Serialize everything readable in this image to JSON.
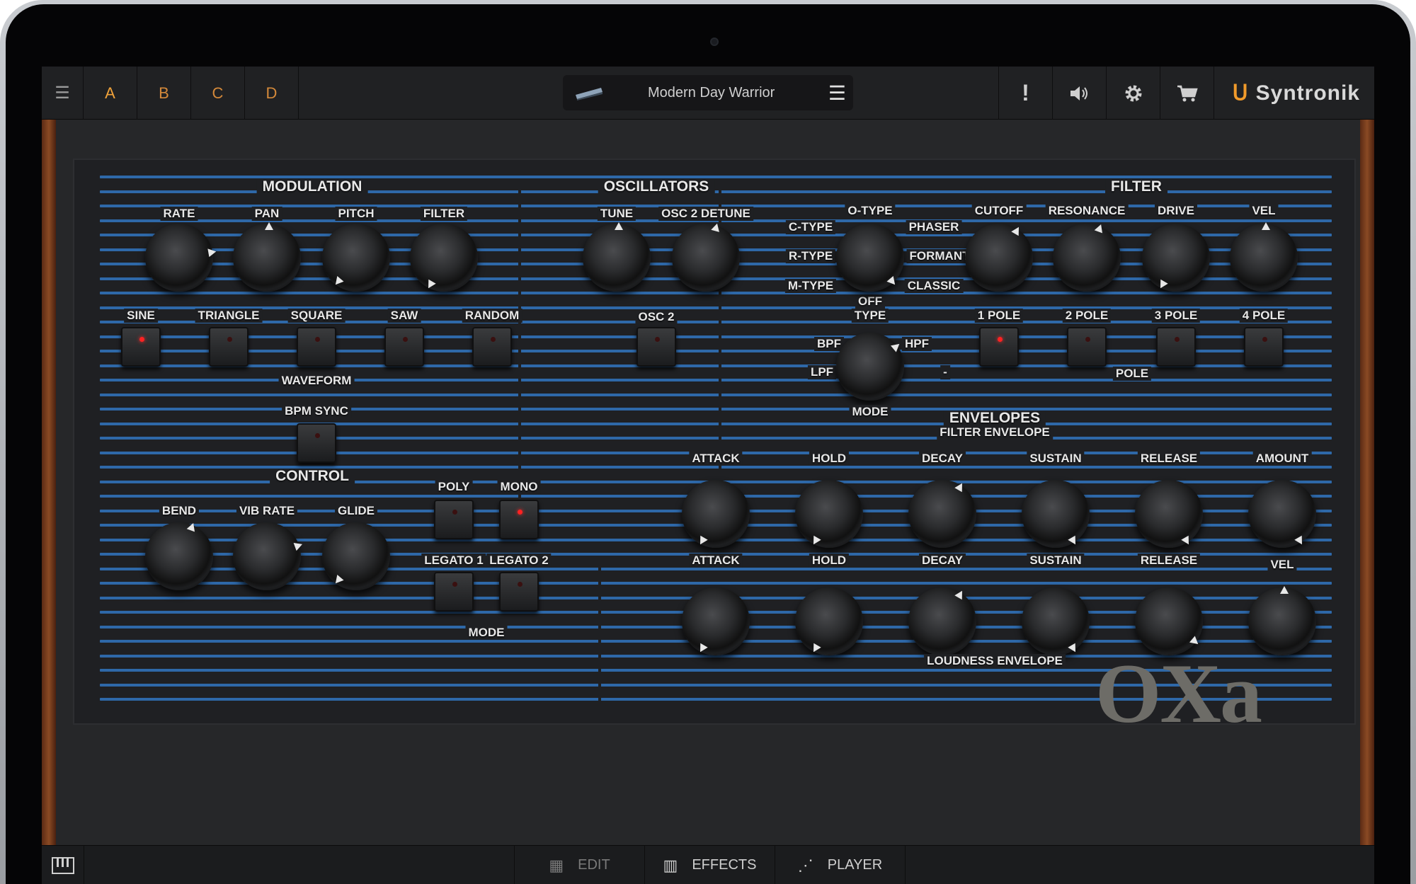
{
  "topbar": {
    "menu_icon": "hamburger-icon",
    "tabs": [
      {
        "label": "A"
      },
      {
        "label": "B"
      },
      {
        "label": "C"
      },
      {
        "label": "D"
      }
    ],
    "preset_name": "Modern Day Warrior",
    "right_icons": [
      "alert-icon",
      "speaker-icon",
      "gear-icon",
      "cart-icon"
    ],
    "alert_glyph": "!",
    "brand": "Syntronik"
  },
  "modulation": {
    "title": "MODULATION",
    "knobs": [
      {
        "label": "RATE"
      },
      {
        "label": "PAN"
      },
      {
        "label": "PITCH"
      },
      {
        "label": "FILTER"
      }
    ],
    "waveforms": [
      {
        "label": "SINE",
        "on": true
      },
      {
        "label": "TRIANGLE",
        "on": false
      },
      {
        "label": "SQUARE",
        "on": false
      },
      {
        "label": "SAW",
        "on": false
      },
      {
        "label": "RANDOM",
        "on": false
      }
    ],
    "waveform_label": "WAVEFORM",
    "bpm_sync": "BPM SYNC"
  },
  "oscillators": {
    "title": "OSCILLATORS",
    "tune": "TUNE",
    "detune": "OSC 2 DETUNE",
    "osc2": "OSC 2"
  },
  "filter": {
    "title": "FILTER",
    "type_options": {
      "o": "O-TYPE",
      "c": "C-TYPE",
      "r": "R-TYPE",
      "m": "M-TYPE",
      "off": "OFF",
      "phaser": "PHASER",
      "formant": "FORMANT",
      "classic": "CLASSIC"
    },
    "type_label": "TYPE",
    "knobs": [
      {
        "label": "CUTOFF"
      },
      {
        "label": "RESONANCE"
      },
      {
        "label": "DRIVE"
      },
      {
        "label": "VEL"
      }
    ],
    "poles": [
      {
        "label": "1 POLE",
        "on": true
      },
      {
        "label": "2 POLE",
        "on": false
      },
      {
        "label": "3 POLE",
        "on": false
      },
      {
        "label": "4 POLE",
        "on": false
      }
    ],
    "pole_label": "POLE",
    "mode_options": {
      "bpf": "BPF",
      "hpf": "HPF",
      "lpf": "LPF",
      "dash": "-"
    },
    "mode_label": "MODE"
  },
  "control": {
    "title": "CONTROL",
    "knobs": [
      {
        "label": "BEND"
      },
      {
        "label": "VIB RATE"
      },
      {
        "label": "GLIDE"
      }
    ],
    "poly": "POLY",
    "mono": "MONO",
    "legato1": "LEGATO 1",
    "legato2": "LEGATO 2",
    "mode": "MODE"
  },
  "envelopes": {
    "title": "ENVELOPES",
    "filter_env": "FILTER ENVELOPE",
    "filter_knobs": [
      {
        "label": "ATTACK"
      },
      {
        "label": "HOLD"
      },
      {
        "label": "DECAY"
      },
      {
        "label": "SUSTAIN"
      },
      {
        "label": "RELEASE"
      },
      {
        "label": "AMOUNT"
      }
    ],
    "loud_knobs": [
      {
        "label": "ATTACK"
      },
      {
        "label": "HOLD"
      },
      {
        "label": "DECAY"
      },
      {
        "label": "SUSTAIN"
      },
      {
        "label": "RELEASE"
      },
      {
        "label": "VEL"
      }
    ],
    "loud_env": "LOUDNESS ENVELOPE"
  },
  "model": "OXa",
  "bottombar": {
    "keyboard_icon": "piano-keys-icon",
    "edit": "EDIT",
    "effects": "EFFECTS",
    "player": "PLAYER"
  },
  "colors": {
    "accent": "#f09a2b",
    "stripe": "#2f6db0",
    "led_on": "#ff2222"
  }
}
